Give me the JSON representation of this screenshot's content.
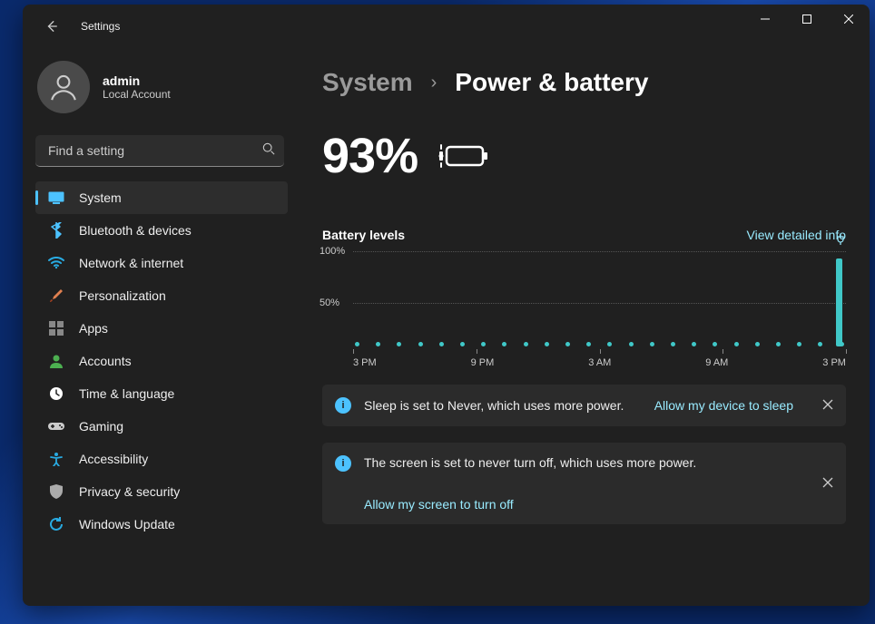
{
  "app_title": "Settings",
  "user": {
    "name": "admin",
    "type": "Local Account"
  },
  "search": {
    "placeholder": "Find a setting"
  },
  "nav": [
    {
      "icon": "system",
      "label": "System",
      "selected": true,
      "color": "#4cc2ff"
    },
    {
      "icon": "bluetooth",
      "label": "Bluetooth & devices",
      "color": "#4cc2ff"
    },
    {
      "icon": "wifi",
      "label": "Network & internet",
      "color": "#29abe2"
    },
    {
      "icon": "brush",
      "label": "Personalization",
      "color": "#e08050"
    },
    {
      "icon": "apps",
      "label": "Apps",
      "color": "#888"
    },
    {
      "icon": "person",
      "label": "Accounts",
      "color": "#4caf50"
    },
    {
      "icon": "clock",
      "label": "Time & language",
      "color": "#fff"
    },
    {
      "icon": "gamepad",
      "label": "Gaming",
      "color": "#ccc"
    },
    {
      "icon": "access",
      "label": "Accessibility",
      "color": "#29abe2"
    },
    {
      "icon": "shield",
      "label": "Privacy & security",
      "color": "#aaa"
    },
    {
      "icon": "update",
      "label": "Windows Update",
      "color": "#29abe2"
    }
  ],
  "breadcrumb": {
    "parent": "System",
    "sep": "›",
    "page": "Power & battery"
  },
  "battery_percent": "93%",
  "battery": {
    "section": "Battery levels",
    "detail_link": "View detailed info"
  },
  "chart_data": {
    "type": "line",
    "title": "Battery levels",
    "ylabel": "%",
    "xlabel": "",
    "ylim": [
      0,
      100
    ],
    "y_ticks": [
      "100%",
      "50%"
    ],
    "x_ticks": [
      "3 PM",
      "9 PM",
      "3 AM",
      "9 AM",
      "3 PM"
    ],
    "n_points": 24,
    "baseline_value": 5,
    "current_bar": {
      "x_index": 23,
      "value": 93
    },
    "plugged_in_at_index": 23
  },
  "infos": [
    {
      "text": "Sleep is set to Never, which uses more power.",
      "link": "Allow my device to sleep",
      "inline": true
    },
    {
      "text": "The screen is set to never turn off, which uses more power.",
      "link": "Allow my screen to turn off",
      "inline": false
    }
  ]
}
